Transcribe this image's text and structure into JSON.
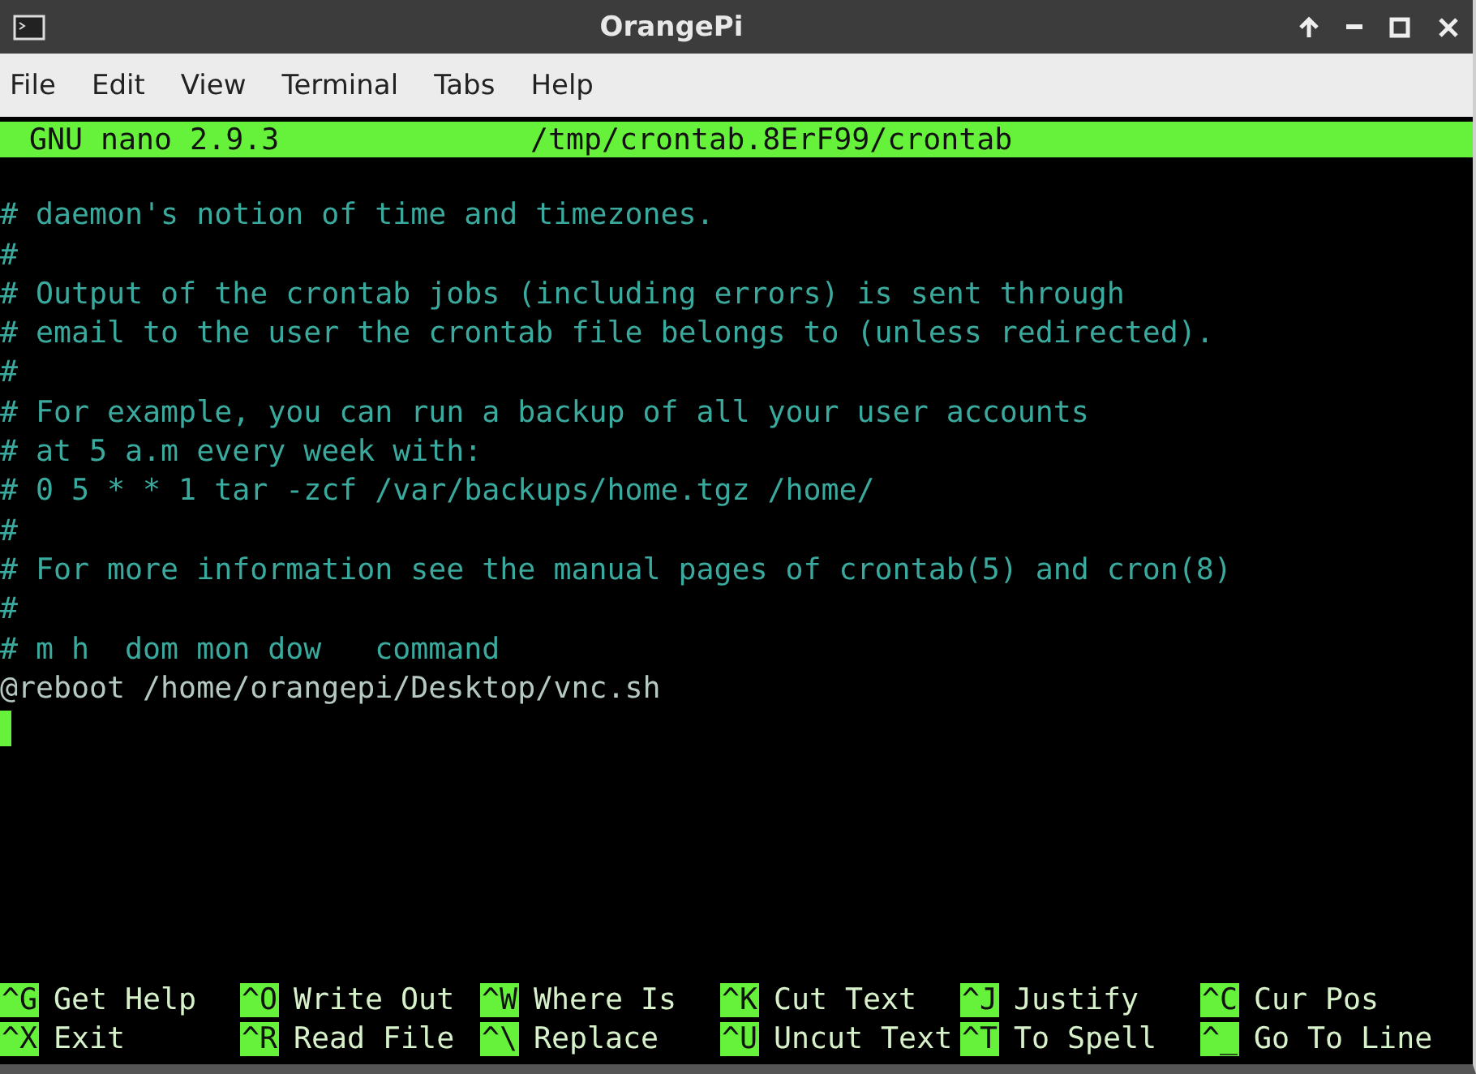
{
  "window": {
    "title": "OrangePi"
  },
  "menu": [
    "File",
    "Edit",
    "View",
    "Terminal",
    "Tabs",
    "Help"
  ],
  "nano_header": {
    "version": "GNU nano 2.9.3",
    "filename": "/tmp/crontab.8ErF99/crontab"
  },
  "lines": [
    {
      "kind": "blank"
    },
    {
      "kind": "comment",
      "text": "# daemon's notion of time and timezones."
    },
    {
      "kind": "comment",
      "text": "#"
    },
    {
      "kind": "comment",
      "text": "# Output of the crontab jobs (including errors) is sent through"
    },
    {
      "kind": "comment",
      "text": "# email to the user the crontab file belongs to (unless redirected)."
    },
    {
      "kind": "comment",
      "text": "#"
    },
    {
      "kind": "comment",
      "text": "# For example, you can run a backup of all your user accounts"
    },
    {
      "kind": "comment",
      "text": "# at 5 a.m every week with:"
    },
    {
      "kind": "comment",
      "text": "# 0 5 * * 1 tar -zcf /var/backups/home.tgz /home/"
    },
    {
      "kind": "comment",
      "text": "#"
    },
    {
      "kind": "comment",
      "text": "# For more information see the manual pages of crontab(5) and cron(8)"
    },
    {
      "kind": "comment",
      "text": "#"
    },
    {
      "kind": "comment",
      "text": "# m h  dom mon dow   command"
    },
    {
      "kind": "command",
      "text": "@reboot /home/orangepi/Desktop/vnc.sh"
    },
    {
      "kind": "cursor"
    }
  ],
  "shortcuts": [
    [
      {
        "key": "^G",
        "label": "Get Help"
      },
      {
        "key": "^O",
        "label": "Write Out"
      },
      {
        "key": "^W",
        "label": "Where Is"
      },
      {
        "key": "^K",
        "label": "Cut Text"
      },
      {
        "key": "^J",
        "label": "Justify"
      },
      {
        "key": "^C",
        "label": "Cur Pos"
      }
    ],
    [
      {
        "key": "^X",
        "label": "Exit"
      },
      {
        "key": "^R",
        "label": "Read File"
      },
      {
        "key": "^\\",
        "label": "Replace"
      },
      {
        "key": "^U",
        "label": "Uncut Text"
      },
      {
        "key": "^T",
        "label": "To Spell"
      },
      {
        "key": "^_",
        "label": "Go To Line"
      }
    ]
  ]
}
